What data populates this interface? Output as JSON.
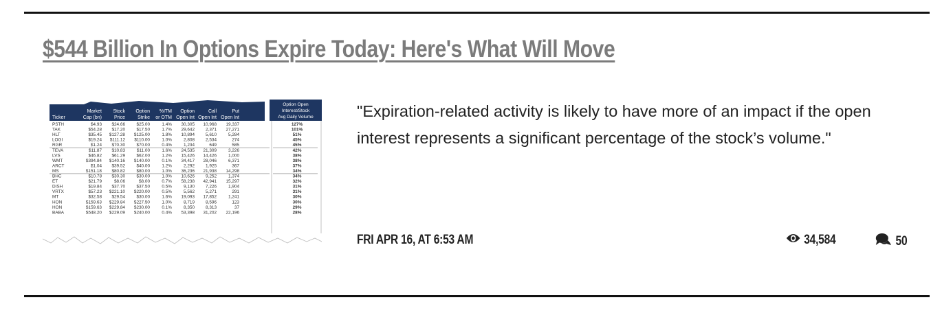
{
  "article": {
    "title": "$544 Billion In Options Expire Today: Here's What Will Move",
    "excerpt": "\"Expiration-related activity is likely to have more of an impact if the open interest represents a significant percentage of the stock’s volume.\"",
    "date": "FRI APR 16, AT 6:53 AM",
    "views": "34,584",
    "comments": "50",
    "views_icon": "eye-icon",
    "comments_icon": "comment-bubbles-icon"
  },
  "thumbnail": {
    "headers": [
      [
        "",
        "Ticker"
      ],
      [
        "Market",
        "Cap (bn)"
      ],
      [
        "Stock",
        "Price"
      ],
      [
        "Option",
        "Strike"
      ],
      [
        "%ITM",
        "or OTM"
      ],
      [
        "Option",
        "Open Int"
      ],
      [
        "Call",
        "Open Int"
      ],
      [
        "Put",
        "Open Int"
      ]
    ],
    "last_header": [
      "Option Open",
      "Interest/Stock",
      "Avg Daily Volume"
    ],
    "rows": [
      [
        "PSTH",
        "$4.93",
        "$24.66",
        "$25.00",
        "1.4%",
        "30,305",
        "10,968",
        "19,337",
        "127%"
      ],
      [
        "TAK",
        "$54.28",
        "$17.20",
        "$17.50",
        "1.7%",
        "29,642",
        "2,371",
        "27,271",
        "101%"
      ],
      [
        "HLT",
        "$35.45",
        "$127.28",
        "$125.00",
        "1.8%",
        "10,894",
        "5,610",
        "5,284",
        "51%"
      ],
      [
        "LOGI",
        "$19.24",
        "$111.12",
        "$110.00",
        "1.0%",
        "2,808",
        "2,534",
        "274",
        "45%"
      ],
      [
        "RGR",
        "$1.24",
        "$70.30",
        "$70.00",
        "0.4%",
        "1,234",
        "649",
        "585",
        "45%"
      ],
      [
        "TEVA",
        "$11.87",
        "$10.83",
        "$11.00",
        "1.6%",
        "24,535",
        "21,309",
        "3,226",
        "42%"
      ],
      [
        "LVS",
        "$46.82",
        "$61.29",
        "$62.00",
        "1.2%",
        "15,426",
        "14,426",
        "1,000",
        "38%"
      ],
      [
        "WMT",
        "$394.84",
        "$140.16",
        "$140.00",
        "0.1%",
        "34,417",
        "28,046",
        "6,371",
        "38%"
      ],
      [
        "ARCT",
        "$1.04",
        "$39.52",
        "$40.00",
        "1.2%",
        "2,292",
        "1,925",
        "367",
        "37%"
      ],
      [
        "MS",
        "$151.18",
        "$80.82",
        "$80.00",
        "1.0%",
        "36,236",
        "21,938",
        "14,298",
        "34%"
      ],
      [
        "BHC",
        "$10.78",
        "$30.30",
        "$30.00",
        "1.0%",
        "10,626",
        "9,252",
        "1,374",
        "34%"
      ],
      [
        "ET",
        "$21.79",
        "$8.06",
        "$8.00",
        "0.7%",
        "58,238",
        "42,941",
        "15,297",
        "32%"
      ],
      [
        "DISH",
        "$19.84",
        "$37.70",
        "$37.50",
        "0.5%",
        "9,130",
        "7,226",
        "1,904",
        "31%"
      ],
      [
        "VRTX",
        "$57.23",
        "$221.10",
        "$220.00",
        "0.5%",
        "5,562",
        "5,271",
        "291",
        "31%"
      ],
      [
        "MT",
        "$32.58",
        "$29.54",
        "$30.00",
        "1.6%",
        "19,093",
        "17,852",
        "1,241",
        "30%"
      ],
      [
        "HON",
        "$159.63",
        "$229.84",
        "$227.50",
        "1.0%",
        "8,719",
        "8,596",
        "123",
        "30%"
      ],
      [
        "HON",
        "$159.63",
        "$229.84",
        "$230.00",
        "0.1%",
        "8,350",
        "8,313",
        "37",
        "29%"
      ],
      [
        "BABA",
        "$548.20",
        "$229.09",
        "$240.00",
        "0.4%",
        "53,398",
        "31,202",
        "22,196",
        "28%"
      ]
    ]
  }
}
